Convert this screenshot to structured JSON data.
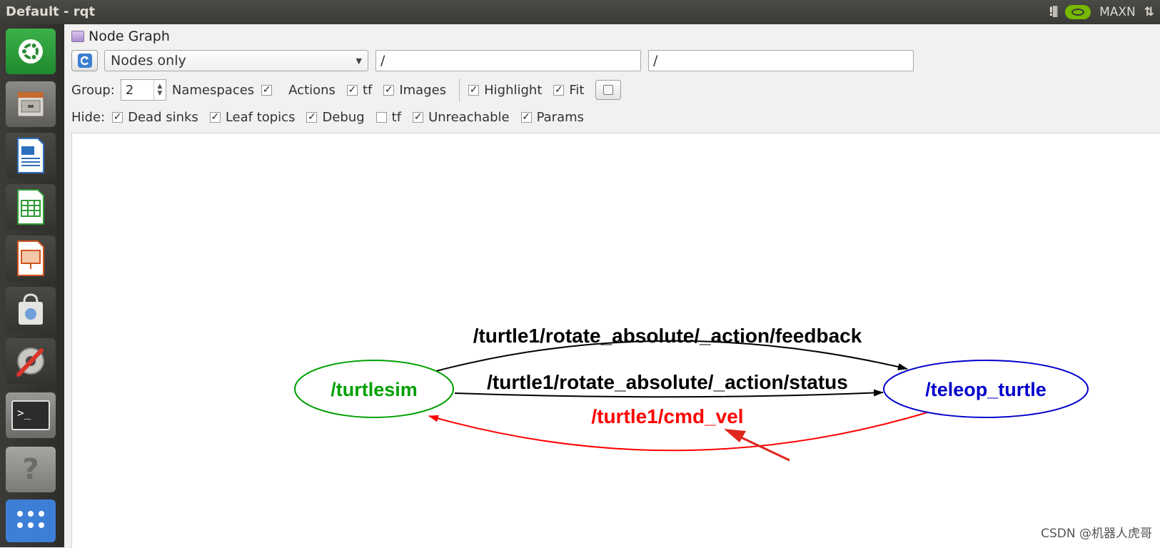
{
  "window": {
    "title": "Default - rqt"
  },
  "tray": {
    "power_mode": "MAXN"
  },
  "plugin": {
    "title": "Node Graph"
  },
  "toolbar": {
    "mode_value": "Nodes only",
    "filter_1_value": "/",
    "filter_2_value": "/"
  },
  "options": {
    "group_label": "Group:",
    "group_value": "2",
    "namespaces": "Namespaces",
    "actions": "Actions",
    "tf": "tf",
    "images": "Images",
    "highlight": "Highlight",
    "fit": "Fit"
  },
  "hide": {
    "label": "Hide:",
    "dead_sinks": "Dead sinks",
    "leaf_topics": "Leaf topics",
    "debug": "Debug",
    "tf": "tf",
    "unreachable": "Unreachable",
    "params": "Params"
  },
  "graph": {
    "nodes": [
      {
        "name": "/turtlesim",
        "color": "#00a000"
      },
      {
        "name": "/teleop_turtle",
        "color": "#0000cc"
      }
    ],
    "edges": [
      {
        "label": "/turtle1/rotate_absolute/_action/feedback",
        "color": "#000000"
      },
      {
        "label": "/turtle1/rotate_absolute/_action/status",
        "color": "#000000"
      },
      {
        "label": "/turtle1/cmd_vel",
        "color": "#ff0000"
      }
    ],
    "annotation_color": "#e0261d"
  },
  "watermark": "CSDN @机器人虎哥"
}
